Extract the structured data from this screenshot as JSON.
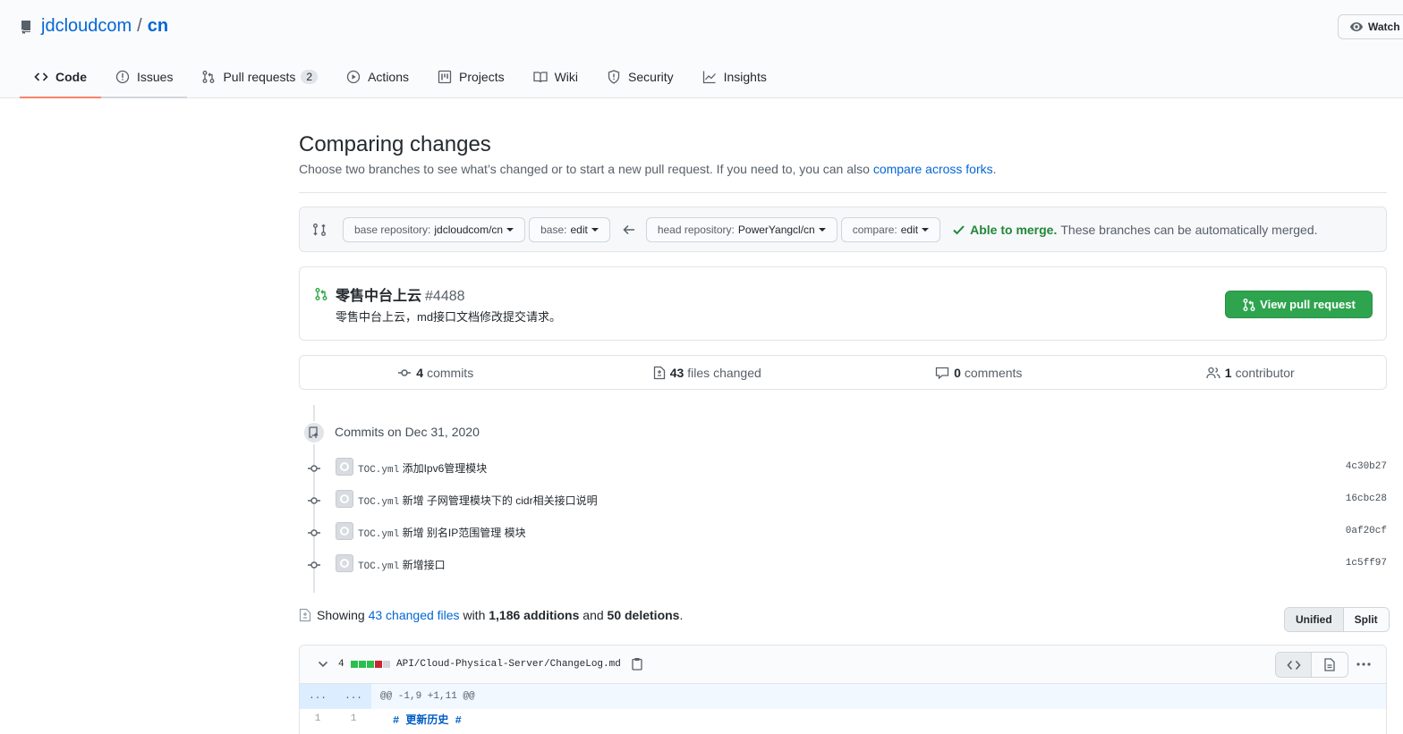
{
  "repo": {
    "owner": "jdcloudcom",
    "separator": "/",
    "name": "cn",
    "watch_label": "Watch"
  },
  "tabs": [
    {
      "label": "Code",
      "icon": "code-icon",
      "selected": true
    },
    {
      "label": "Issues",
      "icon": "issue-opened-icon"
    },
    {
      "label": "Pull requests",
      "icon": "git-pull-request-icon",
      "counter": "2"
    },
    {
      "label": "Actions",
      "icon": "play-icon"
    },
    {
      "label": "Projects",
      "icon": "project-icon"
    },
    {
      "label": "Wiki",
      "icon": "book-icon"
    },
    {
      "label": "Security",
      "icon": "shield-icon"
    },
    {
      "label": "Insights",
      "icon": "graph-icon"
    }
  ],
  "compare": {
    "title": "Comparing changes",
    "description": "Choose two branches to see what’s changed or to start a new pull request. If you need to, you can also",
    "forks_link": "compare across forks",
    "description_end": ".",
    "base_repo_label": "base repository:",
    "base_repo_value": "jdcloudcom/cn",
    "base_label": "base:",
    "base_value": "edit",
    "head_repo_label": "head repository:",
    "head_repo_value": "PowerYangcl/cn",
    "compare_label": "compare:",
    "compare_value": "edit",
    "merge_ok": "Able to merge.",
    "merge_text": "These branches can be automatically merged."
  },
  "pull_request": {
    "title": "零售中台上云",
    "number": "#4488",
    "body": "零售中台上云，md接口文档修改提交请求。",
    "button": "View pull request"
  },
  "numbers": {
    "commits_count": "4",
    "commits_label": "commits",
    "files_count": "43",
    "files_label": "files changed",
    "comments_count": "0",
    "comments_label": "comments",
    "contributors_count": "1",
    "contributors_label": "contributor"
  },
  "commits_header": "Commits on Dec 31, 2020",
  "commits": [
    {
      "file": "TOC.yml",
      "message": "添加Ipv6管理模块",
      "sha": "4c30b27"
    },
    {
      "file": "TOC.yml",
      "message": "新增  子网管理模块下的 cidr相关接口说明",
      "sha": "16cbc28"
    },
    {
      "file": "TOC.yml",
      "message": "新增  别名IP范围管理  模块",
      "sha": "0af20cf"
    },
    {
      "file": "TOC.yml",
      "message": "新增接口",
      "sha": "1c5ff97"
    }
  ],
  "summary": {
    "showing": "Showing",
    "changed_files": "43 changed files",
    "with": "with",
    "additions": "1,186 additions",
    "and": "and",
    "deletions": "50 deletions",
    "end": "."
  },
  "view_toggle": {
    "unified": "Unified",
    "split": "Split"
  },
  "file_diff": {
    "count": "4",
    "path": "API/Cloud-Physical-Server/ChangeLog.md",
    "hunk_left": "...",
    "hunk_right": "...",
    "hunk_header": "@@ -1,9 +1,11 @@",
    "line_old": "1",
    "line_new": "1",
    "line_code": "# 更新历史 #"
  },
  "colors": {
    "accent": "#0366d6",
    "selected_tab_border": "#f9826c",
    "green": "#2ea44f",
    "merge_green": "#22863a",
    "diff_add": "#2cbe4e",
    "diff_del": "#cb2431",
    "diff_neutral": "#d1d5da"
  }
}
